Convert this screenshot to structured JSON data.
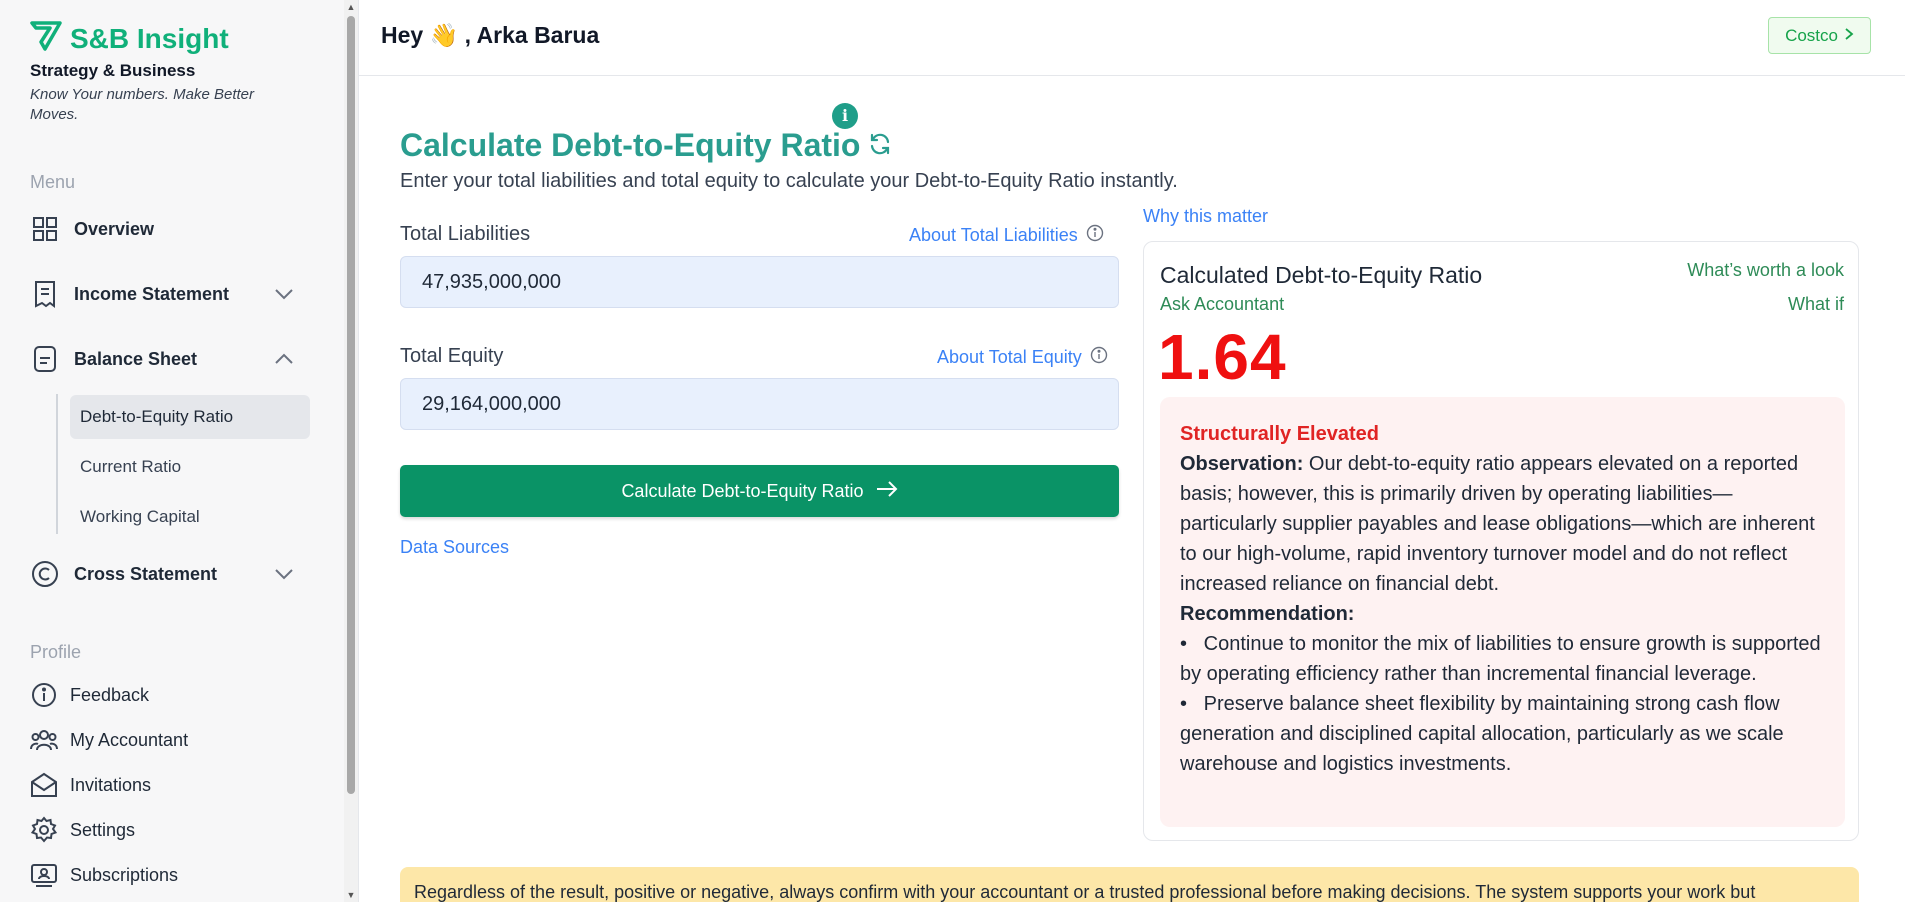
{
  "brand": {
    "name": "S&B Insight",
    "subtitle": "Strategy & Business",
    "tagline": "Know Your numbers. Make Better Moves.",
    "accent": "#10b07a"
  },
  "sidebar": {
    "menu_label": "Menu",
    "items": [
      {
        "label": "Overview",
        "icon": "grid-icon"
      },
      {
        "label": "Income Statement",
        "icon": "receipt-icon",
        "chevron": "down"
      },
      {
        "label": "Balance Sheet",
        "icon": "document-icon",
        "chevron": "up"
      },
      {
        "label": "Cross Statement",
        "icon": "copyright-icon",
        "chevron": "down"
      }
    ],
    "balance_sheet_sub": [
      {
        "label": "Debt-to-Equity Ratio",
        "active": true
      },
      {
        "label": "Current Ratio"
      },
      {
        "label": "Working Capital"
      }
    ],
    "profile_label": "Profile",
    "profile_items": [
      {
        "label": "Feedback",
        "icon": "info-icon"
      },
      {
        "label": "My Accountant",
        "icon": "users-icon"
      },
      {
        "label": "Invitations",
        "icon": "envelope-icon"
      },
      {
        "label": "Settings",
        "icon": "gear-icon"
      },
      {
        "label": "Subscriptions",
        "icon": "subscription-icon"
      }
    ]
  },
  "header": {
    "greeting": "Hey 👋 , Arka Barua",
    "company_button": "Costco"
  },
  "main": {
    "title": "Calculate Debt-to-Equity Ratio",
    "subtitle": "Enter your total liabilities and total equity to calculate your Debt-to-Equity Ratio instantly.",
    "liabilities": {
      "label": "Total Liabilities",
      "about": "About Total Liabilities",
      "value": "47,935,000,000"
    },
    "equity": {
      "label": "Total Equity",
      "about": "About Total Equity",
      "value": "29,164,000,000"
    },
    "calculate_button": "Calculate Debt-to-Equity Ratio",
    "data_sources": "Data Sources",
    "why_link": "Why this matter"
  },
  "result": {
    "title": "Calculated Debt-to-Equity Ratio",
    "worth_look": "What’s worth a look",
    "ask_accountant": "Ask Accountant",
    "what_if": "What if",
    "value": "1.64",
    "value_color": "#ef1010",
    "status": "Structurally Elevated",
    "observation_label": "Observation:",
    "observation_text": " Our debt-to-equity ratio appears elevated on a reported basis; however, this is primarily driven by operating liabilities—particularly supplier payables and lease obligations—which are inherent to our high-volume, rapid inventory turnover model and do not reflect increased reliance on financial debt.",
    "recommendation_label": "Recommendation:",
    "recommendations": [
      "Continue to monitor the mix of liabilities to ensure growth is supported by operating efficiency rather than incremental financial leverage.",
      "Preserve balance sheet flexibility by maintaining strong cash flow generation and disciplined capital allocation, particularly as we scale warehouse and logistics investments."
    ]
  },
  "disclaimer": "Regardless of the result, positive or negative, always confirm with your accountant or a trusted professional before making decisions. The system supports your work but"
}
